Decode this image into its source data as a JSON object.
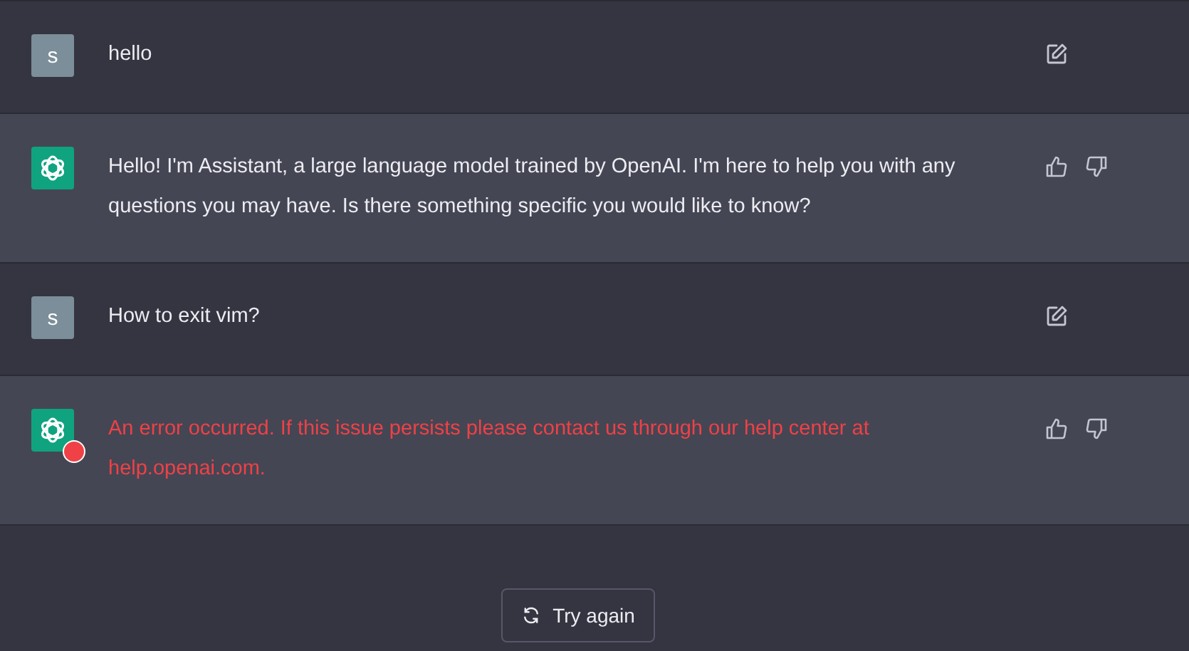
{
  "messages": [
    {
      "kind": "user",
      "avatar": "s",
      "text": "hello"
    },
    {
      "kind": "assistant",
      "text": "Hello! I'm Assistant, a large language model trained by OpenAI. I'm here to help you with any questions you may have. Is there something specific you would like to know?"
    },
    {
      "kind": "user",
      "avatar": "s",
      "text": "How to exit vim?"
    },
    {
      "kind": "error",
      "text": "An error occurred. If this issue persists please contact us through our help center at help.openai.com."
    }
  ],
  "retry_button": {
    "label": "Try again"
  }
}
